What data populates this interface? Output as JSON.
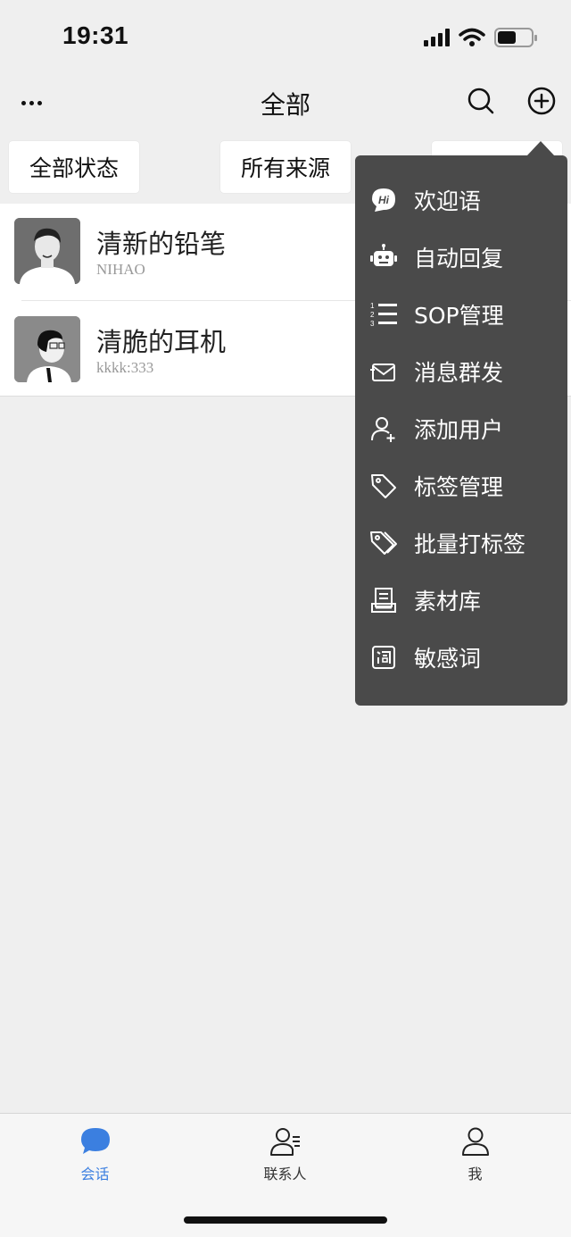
{
  "status_bar": {
    "time": "19:31"
  },
  "header": {
    "title": "全部"
  },
  "filters": [
    {
      "label": "全部状态"
    },
    {
      "label": "所有来源"
    }
  ],
  "chats": [
    {
      "name": "清新的铅笔",
      "preview": "NIHAO"
    },
    {
      "name": "清脆的耳机",
      "preview": "kkkk:333"
    }
  ],
  "menu": {
    "items": [
      {
        "label": "欢迎语",
        "icon": "hi-bubble-icon"
      },
      {
        "label": "自动回复",
        "icon": "robot-icon"
      },
      {
        "label": "SOP管理",
        "icon": "numbered-list-icon"
      },
      {
        "label": "消息群发",
        "icon": "envelope-icon"
      },
      {
        "label": "添加用户",
        "icon": "add-user-icon"
      },
      {
        "label": "标签管理",
        "icon": "tag-icon"
      },
      {
        "label": "批量打标签",
        "icon": "tags-icon"
      },
      {
        "label": "素材库",
        "icon": "archive-icon"
      },
      {
        "label": "敏感词",
        "icon": "word-box-icon"
      }
    ]
  },
  "tabs": [
    {
      "label": "会话",
      "icon": "chat-bubble-icon",
      "active": true
    },
    {
      "label": "联系人",
      "icon": "contacts-icon",
      "active": false
    },
    {
      "label": "我",
      "icon": "person-icon",
      "active": false
    }
  ],
  "colors": {
    "accent": "#3b7fe0",
    "menu_bg": "#4a4a4a",
    "page_bg": "#efefef"
  }
}
